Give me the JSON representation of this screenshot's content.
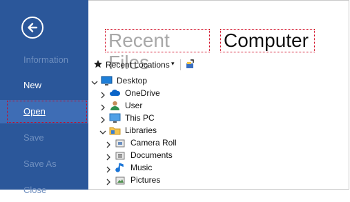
{
  "sidebar": {
    "back_label": "Back",
    "items": [
      {
        "label": "Information",
        "state": "disabled"
      },
      {
        "label": "New",
        "state": "normal"
      },
      {
        "label": "Open",
        "state": "selected"
      },
      {
        "label": "Save",
        "state": "disabled"
      },
      {
        "label": "Save As",
        "state": "disabled"
      },
      {
        "label": "Close",
        "state": "disabled"
      }
    ]
  },
  "header": {
    "recent_files": "Recent Files",
    "computer": "Computer"
  },
  "toolbar": {
    "recent_locations": "Recent Locations"
  },
  "tree": [
    {
      "label": "Desktop",
      "expander": "expanded",
      "icon": "desktop-icon"
    },
    {
      "label": "OneDrive",
      "expander": "collapsed",
      "icon": "cloud-icon"
    },
    {
      "label": "User",
      "expander": "collapsed",
      "icon": "user-icon"
    },
    {
      "label": "This PC",
      "expander": "collapsed",
      "icon": "monitor-icon"
    },
    {
      "label": "Libraries",
      "expander": "expanded",
      "icon": "folder-icon"
    },
    {
      "label": "Camera Roll",
      "expander": "collapsed",
      "icon": "library-icon"
    },
    {
      "label": "Documents",
      "expander": "collapsed",
      "icon": "library-icon"
    },
    {
      "label": "Music",
      "expander": "collapsed",
      "icon": "music-icon"
    },
    {
      "label": "Pictures",
      "expander": "collapsed",
      "icon": "library-icon"
    }
  ],
  "colors": {
    "sidebar": "#2b579a",
    "selected": "#3e6db5",
    "disabled_text": "#6f8fbf",
    "annotation": "#d0021b"
  }
}
